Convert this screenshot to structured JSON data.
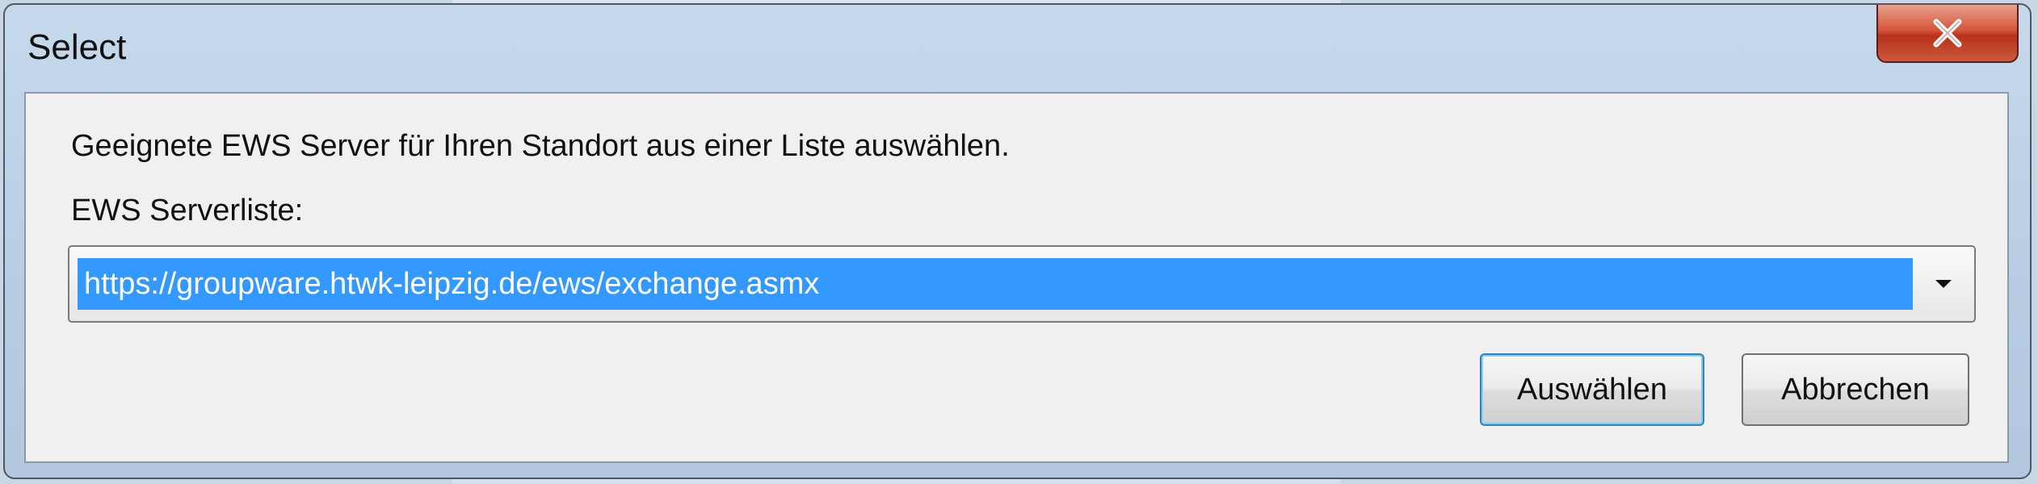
{
  "window": {
    "title": "Select",
    "close_icon": "close-icon"
  },
  "dialog": {
    "description": "Geeignete EWS Server für Ihren Standort aus einer Liste auswählen.",
    "list_label": "EWS Serverliste:",
    "server_select": {
      "value": "https://groupware.htwk-leipzig.de/ews/exchange.asmx",
      "arrow_icon": "chevron-down-icon"
    },
    "buttons": {
      "select_label": "Auswählen",
      "cancel_label": "Abbrechen"
    }
  },
  "colors": {
    "selection": "#3399ff",
    "close_button": "#c9453a",
    "frame": "#b8cde3"
  }
}
